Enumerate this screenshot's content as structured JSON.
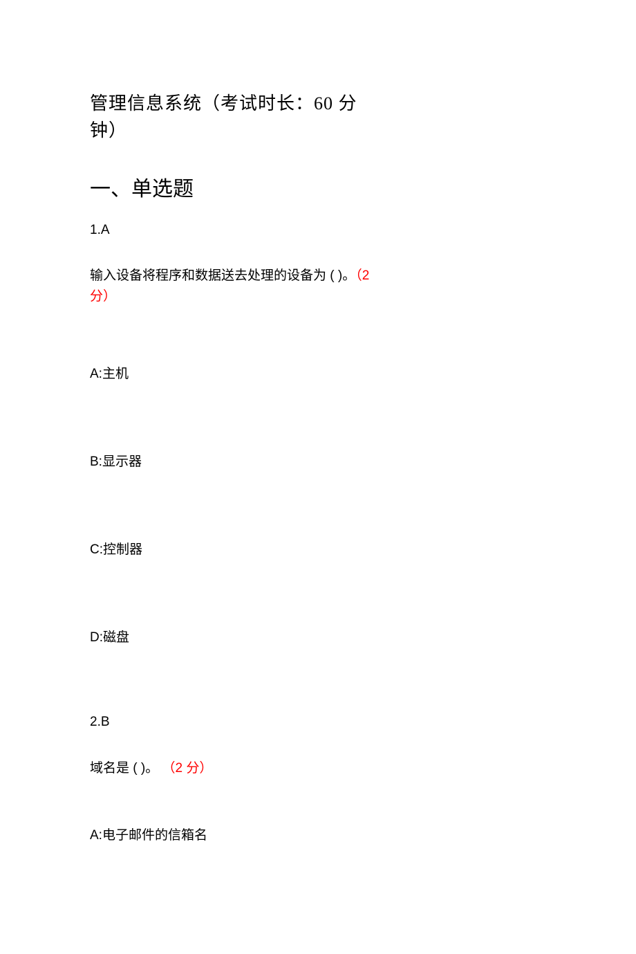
{
  "title_line1": "管理信息系统（考试时长：60 分",
  "title_line2": "钟）",
  "section_heading": "一、单选题",
  "q1": {
    "number": "1.A",
    "text_main": "输入设备将程序和数据送去处理的设备为 ( )。",
    "points_part1": "（2",
    "points_part2": "分）",
    "options": {
      "a": "A:主机",
      "b": "B:显示器",
      "c": "C:控制器",
      "d": "D:磁盘"
    }
  },
  "q2": {
    "number": "2.B",
    "text_main": "域名是 ( )。 ",
    "points": "（2 分）",
    "options": {
      "a": "A:电子邮件的信箱名"
    }
  }
}
